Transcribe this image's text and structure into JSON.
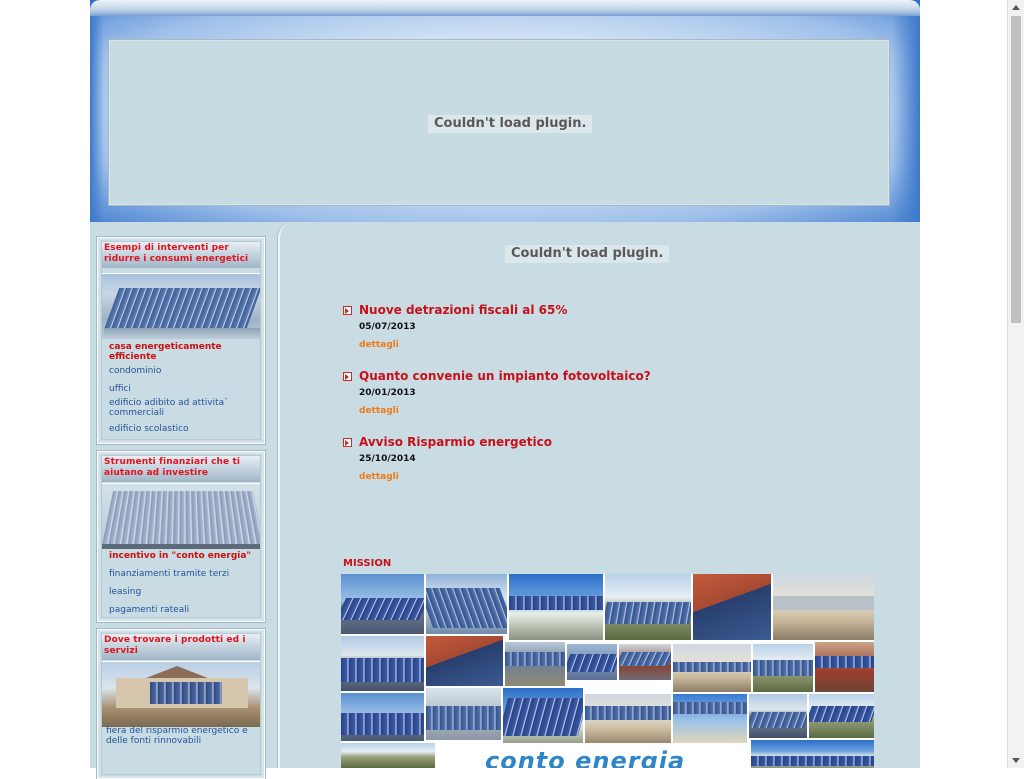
{
  "header": {
    "plugin_message": "Couldn't load plugin."
  },
  "sidebar": {
    "boxes": [
      {
        "title": "Esempi di interventi per ridurre i consumi energetici",
        "image": "solar-roof-photo",
        "links": [
          {
            "label": "casa energeticamente efficiente",
            "highlight": true
          },
          {
            "label": "condominio",
            "highlight": false
          },
          {
            "label": "uffici",
            "highlight": false
          },
          {
            "label": "edificio adibito ad attivita` commerciali",
            "highlight": false
          },
          {
            "label": "edificio scolastico",
            "highlight": false
          }
        ]
      },
      {
        "title": "Strumenti finanziari che ti aiutano ad investire",
        "image": "solar-array-photo",
        "links": [
          {
            "label": "incentivo in \"conto energia\"",
            "highlight": true
          },
          {
            "label": "finanziamenti tramite terzi",
            "highlight": false
          },
          {
            "label": "leasing",
            "highlight": false
          },
          {
            "label": "pagamenti rateali",
            "highlight": false
          }
        ]
      },
      {
        "title": "Dove trovare i prodotti ed i servizi",
        "image": "solar-house-photo",
        "links": [
          {
            "label": "fiera del risparmio energetico e delle fonti rinnovabili",
            "highlight": false
          }
        ]
      }
    ]
  },
  "main": {
    "plugin_message": "Couldn't load plugin.",
    "news": [
      {
        "title": "Nuove detrazioni fiscali al 65%",
        "date": "05/07/2013",
        "link": "dettagli"
      },
      {
        "title": "Quanto convenie un impianto fotovoltaico?",
        "date": "20/01/2013",
        "link": "dettagli"
      },
      {
        "title": "Avviso Risparmio energetico",
        "date": "25/10/2014",
        "link": "dettagli"
      }
    ],
    "mission_label": "MISSION",
    "collage_logo_text": "conto energia"
  },
  "colors": {
    "accent_red": "#c8101b",
    "link_blue": "#24529a",
    "detail_orange": "#f07a18",
    "content_bg": "#c9dce3",
    "header_blue": "#2f6fc9"
  }
}
